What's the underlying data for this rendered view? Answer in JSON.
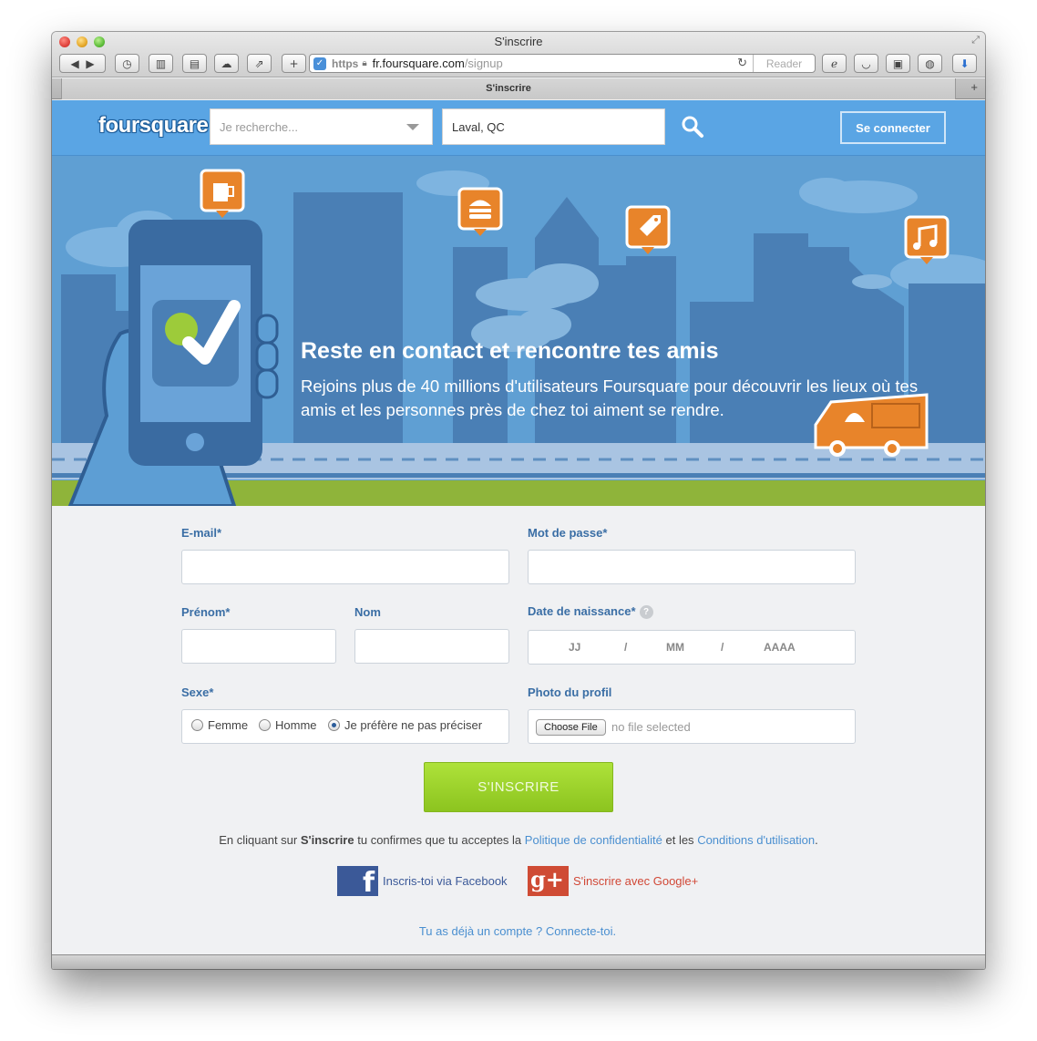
{
  "window": {
    "title": "S'inscrire"
  },
  "toolbar": {
    "url_https": "https",
    "url_host": "fr.foursquare.com",
    "url_path": "/signup",
    "reader_label": "Reader"
  },
  "tabs": [
    {
      "label": "S'inscrire"
    }
  ],
  "header": {
    "logo": "foursquare",
    "search_placeholder": "Je recherche...",
    "location_value": "Laval, QC",
    "login_label": "Se connecter"
  },
  "hero": {
    "title": "Reste en contact et rencontre tes amis",
    "subtitle": "Rejoins plus de 40 millions d'utilisateurs Foursquare pour découvrir les lieux où tes amis et les personnes près de chez toi aiment se rendre."
  },
  "form": {
    "email_label": "E-mail*",
    "password_label": "Mot de passe*",
    "firstname_label": "Prénom*",
    "lastname_label": "Nom",
    "dob_label": "Date de naissance*",
    "dob_help": "?",
    "dob_day": "JJ",
    "dob_month": "MM",
    "dob_year": "AAAA",
    "dob_sep": "/",
    "gender_label": "Sexe*",
    "gender_options": [
      "Femme",
      "Homme",
      "Je préfère ne pas préciser"
    ],
    "gender_selected": "Je préfère ne pas préciser",
    "photo_label": "Photo du profil",
    "choose_file": "Choose File",
    "no_file": "no file selected",
    "submit_label": "S'INSCRIRE"
  },
  "terms": {
    "prefix": "En cliquant sur",
    "bold": "S'inscrire",
    "middle": "tu confirmes que tu acceptes la",
    "privacy_link": "Politique de confidentialité",
    "and": "et les",
    "conditions_link": "Conditions d'utilisation",
    "suffix": "."
  },
  "social": {
    "facebook_label": "Inscris-toi via Facebook",
    "google_label": "S'inscrire avec Google+",
    "facebook_glyph": "f",
    "google_glyph": "g+"
  },
  "footer": {
    "already_label": "Tu as déjà un compte ? Connecte-toi."
  },
  "colors": {
    "topnav": "#5aa5e4",
    "hero_sky": "#5592c6",
    "accent_orange": "#e8842a",
    "submit_green": "#9fd42c",
    "link_blue": "#4a8fd0",
    "label_blue": "#3a6ea5"
  }
}
